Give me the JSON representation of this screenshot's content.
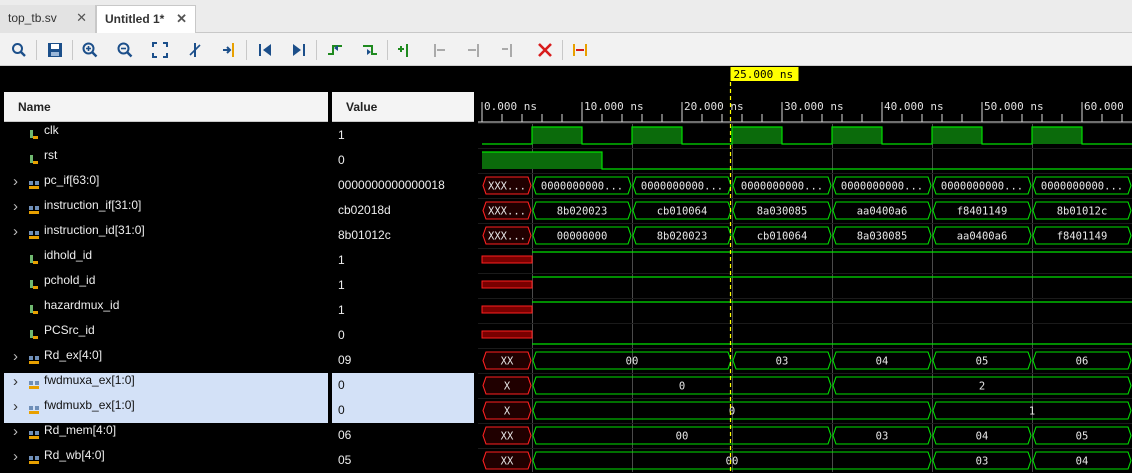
{
  "tabs": [
    {
      "label": "top_tb.sv",
      "close": "✕"
    },
    {
      "label": "Untitled 1*",
      "close": "✕"
    }
  ],
  "toolbar_icons": [
    "search-icon",
    "save-icon",
    "zoom-in-icon",
    "zoom-out-icon",
    "zoom-fit-icon",
    "cursor-icon",
    "goto-cursor-icon",
    "go-to-start-icon",
    "go-to-end-icon",
    "prev-transition-icon",
    "next-transition-icon",
    "add-marker-icon",
    "prev-marker-icon",
    "next-marker-icon",
    "remove-marker-icon",
    "delete-icon",
    "snap-icon"
  ],
  "columns": {
    "name": "Name",
    "value": "Value"
  },
  "cursor_label": "25.000 ns",
  "time_axis": [
    "0.000 ns",
    "10.000 ns",
    "20.000 ns",
    "30.000 ns",
    "40.000 ns",
    "50.000 ns",
    "60.000"
  ],
  "signals": [
    {
      "name": "clk",
      "value": "1",
      "kind": "bit",
      "expandable": false,
      "selected": false
    },
    {
      "name": "rst",
      "value": "0",
      "kind": "bit",
      "expandable": false,
      "selected": false
    },
    {
      "name": "pc_if[63:0]",
      "value": "0000000000000018",
      "kind": "bus",
      "expandable": true,
      "selected": false
    },
    {
      "name": "instruction_if[31:0]",
      "value": "cb02018d",
      "kind": "bus",
      "expandable": true,
      "selected": false
    },
    {
      "name": "instruction_id[31:0]",
      "value": "8b01012c",
      "kind": "bus",
      "expandable": true,
      "selected": false
    },
    {
      "name": "idhold_id",
      "value": "1",
      "kind": "bit",
      "expandable": false,
      "selected": false
    },
    {
      "name": "pchold_id",
      "value": "1",
      "kind": "bit",
      "expandable": false,
      "selected": false
    },
    {
      "name": "hazardmux_id",
      "value": "1",
      "kind": "bit",
      "expandable": false,
      "selected": false
    },
    {
      "name": "PCSrc_id",
      "value": "0",
      "kind": "bit",
      "expandable": false,
      "selected": false
    },
    {
      "name": "Rd_ex[4:0]",
      "value": "09",
      "kind": "bus",
      "expandable": true,
      "selected": false
    },
    {
      "name": "fwdmuxa_ex[1:0]",
      "value": "0",
      "kind": "bus",
      "expandable": true,
      "selected": true
    },
    {
      "name": "fwdmuxb_ex[1:0]",
      "value": "0",
      "kind": "bus",
      "expandable": true,
      "selected": true
    },
    {
      "name": "Rd_mem[4:0]",
      "value": "06",
      "kind": "bus",
      "expandable": true,
      "selected": false
    },
    {
      "name": "Rd_wb[4:0]",
      "value": "05",
      "kind": "bus",
      "expandable": true,
      "selected": false
    }
  ],
  "waves": [
    {
      "type": "clock",
      "first_high": 5,
      "period": 10
    },
    {
      "type": "bit",
      "segments": [
        {
          "t0": 0,
          "t1": 12,
          "v": 1
        },
        {
          "t0": 12,
          "t1": 65,
          "v": 0
        }
      ]
    },
    {
      "type": "bus",
      "segments": [
        {
          "t0": 0,
          "t1": 5,
          "label": "XXX...",
          "x": true
        },
        {
          "t0": 5,
          "t1": 15,
          "label": "0000000000..."
        },
        {
          "t0": 15,
          "t1": 25,
          "label": "0000000000..."
        },
        {
          "t0": 25,
          "t1": 35,
          "label": "0000000000..."
        },
        {
          "t0": 35,
          "t1": 45,
          "label": "0000000000..."
        },
        {
          "t0": 45,
          "t1": 55,
          "label": "0000000000..."
        },
        {
          "t0": 55,
          "t1": 65,
          "label": "0000000000..."
        }
      ]
    },
    {
      "type": "bus",
      "segments": [
        {
          "t0": 0,
          "t1": 5,
          "label": "XXX...",
          "x": true
        },
        {
          "t0": 5,
          "t1": 15,
          "label": "8b020023"
        },
        {
          "t0": 15,
          "t1": 25,
          "label": "cb010064"
        },
        {
          "t0": 25,
          "t1": 35,
          "label": "8a030085"
        },
        {
          "t0": 35,
          "t1": 45,
          "label": "aa0400a6"
        },
        {
          "t0": 45,
          "t1": 55,
          "label": "f8401149"
        },
        {
          "t0": 55,
          "t1": 65,
          "label": "8b01012c"
        }
      ]
    },
    {
      "type": "bus",
      "segments": [
        {
          "t0": 0,
          "t1": 5,
          "label": "XXX...",
          "x": true
        },
        {
          "t0": 5,
          "t1": 15,
          "label": "00000000"
        },
        {
          "t0": 15,
          "t1": 25,
          "label": "8b020023"
        },
        {
          "t0": 25,
          "t1": 35,
          "label": "cb010064"
        },
        {
          "t0": 35,
          "t1": 45,
          "label": "8a030085"
        },
        {
          "t0": 45,
          "t1": 55,
          "label": "aa0400a6"
        },
        {
          "t0": 55,
          "t1": 65,
          "label": "f8401149"
        }
      ]
    },
    {
      "type": "bit",
      "segments": [
        {
          "t0": 0,
          "t1": 5,
          "v": "x"
        },
        {
          "t0": 5,
          "t1": 65,
          "v": 1
        }
      ]
    },
    {
      "type": "bit",
      "segments": [
        {
          "t0": 0,
          "t1": 5,
          "v": "x"
        },
        {
          "t0": 5,
          "t1": 65,
          "v": 1
        }
      ]
    },
    {
      "type": "bit",
      "segments": [
        {
          "t0": 0,
          "t1": 5,
          "v": "x"
        },
        {
          "t0": 5,
          "t1": 65,
          "v": 1
        }
      ]
    },
    {
      "type": "bit",
      "segments": [
        {
          "t0": 0,
          "t1": 5,
          "v": "x"
        },
        {
          "t0": 5,
          "t1": 65,
          "v": 0
        }
      ]
    },
    {
      "type": "bus",
      "segments": [
        {
          "t0": 0,
          "t1": 5,
          "label": "XX",
          "x": true
        },
        {
          "t0": 5,
          "t1": 25,
          "label": "00"
        },
        {
          "t0": 25,
          "t1": 35,
          "label": "03"
        },
        {
          "t0": 35,
          "t1": 45,
          "label": "04"
        },
        {
          "t0": 45,
          "t1": 55,
          "label": "05"
        },
        {
          "t0": 55,
          "t1": 65,
          "label": "06"
        }
      ]
    },
    {
      "type": "bus",
      "segments": [
        {
          "t0": 0,
          "t1": 5,
          "label": "X",
          "x": true
        },
        {
          "t0": 5,
          "t1": 35,
          "label": "0"
        },
        {
          "t0": 35,
          "t1": 65,
          "label": "2"
        }
      ]
    },
    {
      "type": "bus",
      "segments": [
        {
          "t0": 0,
          "t1": 5,
          "label": "X",
          "x": true
        },
        {
          "t0": 5,
          "t1": 45,
          "label": "0"
        },
        {
          "t0": 45,
          "t1": 65,
          "label": "1"
        }
      ]
    },
    {
      "type": "bus",
      "segments": [
        {
          "t0": 0,
          "t1": 5,
          "label": "XX",
          "x": true
        },
        {
          "t0": 5,
          "t1": 35,
          "label": "00"
        },
        {
          "t0": 35,
          "t1": 45,
          "label": "03"
        },
        {
          "t0": 45,
          "t1": 55,
          "label": "04"
        },
        {
          "t0": 55,
          "t1": 65,
          "label": "05"
        }
      ]
    },
    {
      "type": "bus",
      "segments": [
        {
          "t0": 0,
          "t1": 5,
          "label": "XX",
          "x": true
        },
        {
          "t0": 5,
          "t1": 45,
          "label": "00"
        },
        {
          "t0": 45,
          "t1": 55,
          "label": "03"
        },
        {
          "t0": 55,
          "t1": 65,
          "label": "04"
        }
      ]
    }
  ],
  "colors": {
    "wave": "#00e000",
    "wave_fill": "#0b6b0b",
    "x_state": "#ff2020",
    "x_fill": "#7a0000",
    "cursor": "#ffff00",
    "grid": "#4a4a4a",
    "selection": "#d3e1f7"
  }
}
